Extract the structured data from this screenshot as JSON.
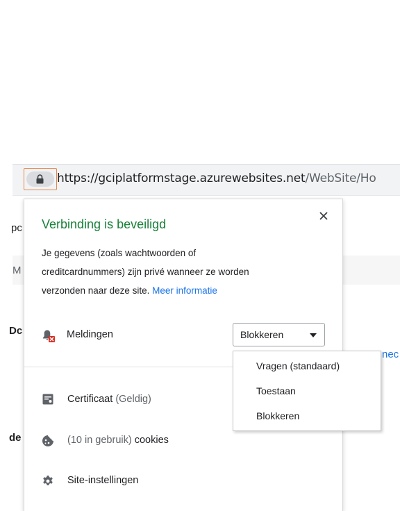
{
  "address_bar": {
    "url_host": "https://gciplatformstage.azurewebsites.net",
    "url_path": "/WebSite/Ho"
  },
  "background_page": {
    "fragment_1": "pc",
    "fragment_2": "M",
    "fragment_3": "Dc",
    "fragment_4": "nec",
    "fragment_5": "de"
  },
  "popup": {
    "title": "Verbinding is beveiligd",
    "description": "Je gegevens (zoals wachtwoorden of creditcardnummers) zijn privé wanneer ze worden verzonden naar deze site.",
    "more_info_link": "Meer informatie",
    "notifications": {
      "label": "Meldingen",
      "selected": "Blokkeren",
      "icon": "bell-blocked-icon"
    },
    "dropdown_options": [
      "Vragen (standaard)",
      "Toestaan",
      "Blokkeren"
    ],
    "certificate": {
      "label": "Certificaat",
      "status": "(Geldig)",
      "icon": "certificate-icon"
    },
    "cookies": {
      "count": "(10 in gebruik)",
      "label": "cookies",
      "icon": "cookie-icon"
    },
    "site_settings": {
      "label": "Site-instellingen",
      "icon": "gear-icon"
    }
  },
  "colors": {
    "secure_green": "#188038",
    "link_blue": "#1a73e8",
    "highlight_orange": "#e8874d",
    "blocked_red": "#d93025"
  }
}
